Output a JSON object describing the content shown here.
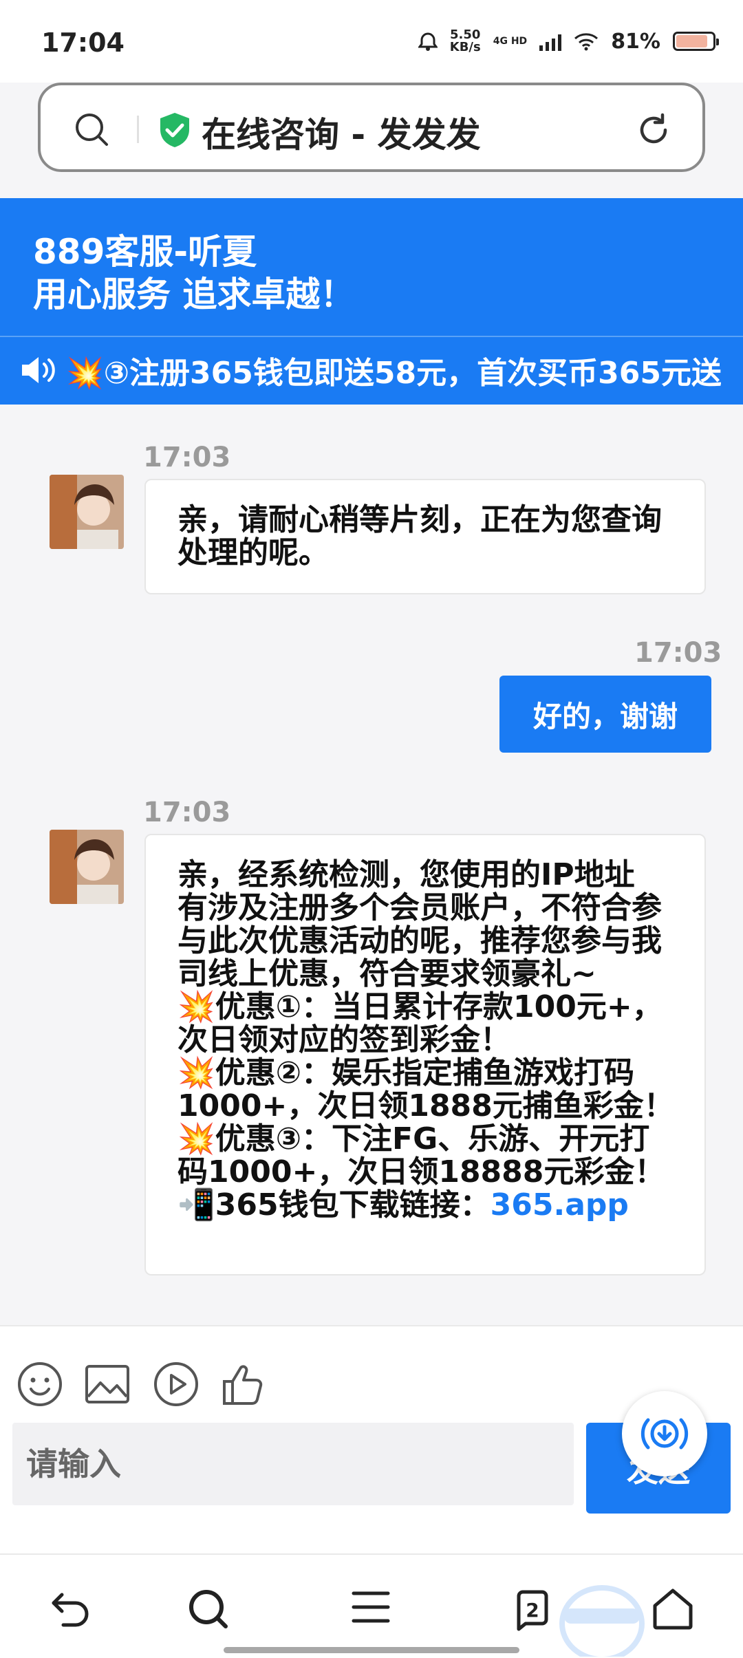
{
  "status_bar": {
    "time": "17:04",
    "net_speed_value": "5.50",
    "net_speed_unit": "KB/s",
    "network_type": "4G HD",
    "battery": "81%",
    "battery_level": 0.81
  },
  "address_bar": {
    "title": "在线咨询 - 发发发"
  },
  "header": {
    "line1": "889客服-听夏",
    "line2": "用心服务 追求卓越！",
    "marquee": "💥③注册365钱包即送58元，首次买币365元送"
  },
  "chat": {
    "messages": [
      {
        "time": "17:03",
        "from": "agent",
        "lines": [
          "亲，请耐心稍等片刻，正在为您查询",
          "处理的呢。"
        ]
      },
      {
        "time": "17:03",
        "from": "user",
        "text": "好的，谢谢"
      },
      {
        "time": "17:03",
        "from": "agent",
        "lines": [
          "亲，经系统检测，您使用的IP地址",
          "有涉及注册多个会员账户，不符合参",
          "与此次优惠活动的呢，推荐您参与我",
          "司线上优惠，符合要求领豪礼~",
          "💥优惠①：当日累计存款100元+，",
          "次日领对应的签到彩金！",
          "💥优惠②：娱乐指定捕鱼游戏打码",
          "1000+，次日领1888元捕鱼彩金！",
          "💥优惠③：下注FG、乐游、开元打",
          "码1000+，次日领18888元彩金！"
        ],
        "link_prefix": "📲365钱包下载链接：",
        "link_text": "365.app"
      }
    ]
  },
  "composer": {
    "placeholder": "请输入",
    "send_label": "发送"
  },
  "colors": {
    "accent": "#1a7bf3",
    "background": "#f5f5f7"
  }
}
